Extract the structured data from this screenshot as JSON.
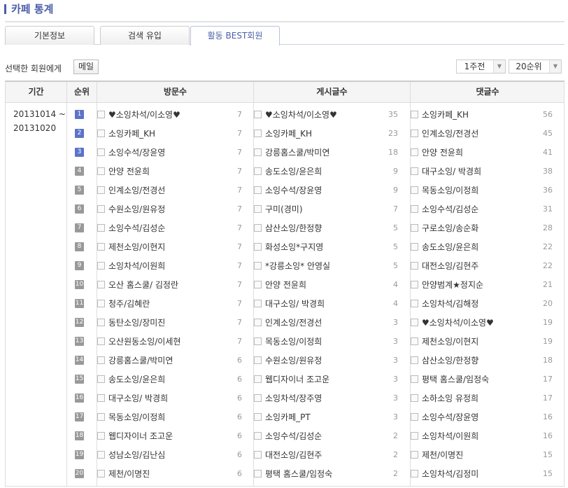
{
  "title": "카페 통계",
  "tabs": [
    {
      "label": "기본정보"
    },
    {
      "label": "검색 유입"
    },
    {
      "label": "활동 BEST회원"
    }
  ],
  "toolbar": {
    "selected_label": "선택한 회원에게",
    "mail_button": "메일",
    "period_select": "1주전",
    "rank_select": "20순위"
  },
  "table": {
    "headers": [
      "기간",
      "순위",
      "방문수",
      "게시글수",
      "댓글수"
    ],
    "period": [
      "20131014 ~",
      "20131020"
    ],
    "rows": [
      {
        "rank": "1",
        "visit": [
          "♥소잉차석/이소영♥",
          "7"
        ],
        "post": [
          "♥소잉차석/이소영♥",
          "35"
        ],
        "comment": [
          "소잉카페_KH",
          "56"
        ]
      },
      {
        "rank": "2",
        "visit": [
          "소잉카페_KH",
          "7"
        ],
        "post": [
          "소잉카페_KH",
          "23"
        ],
        "comment": [
          "인계소잉/전경선",
          "45"
        ]
      },
      {
        "rank": "3",
        "visit": [
          "소잉수석/장윤영",
          "7"
        ],
        "post": [
          "강릉홈스쿨/박미연",
          "18"
        ],
        "comment": [
          "안양 전윤희",
          "41"
        ]
      },
      {
        "rank": "4",
        "visit": [
          "안양 전윤희",
          "7"
        ],
        "post": [
          "송도소잉/윤은희",
          "9"
        ],
        "comment": [
          "대구소잉/ 박경희",
          "38"
        ]
      },
      {
        "rank": "5",
        "visit": [
          "인계소잉/전경선",
          "7"
        ],
        "post": [
          "소잉수석/장윤영",
          "9"
        ],
        "comment": [
          "목동소잉/이정희",
          "36"
        ]
      },
      {
        "rank": "6",
        "visit": [
          "수원소잉/원유정",
          "7"
        ],
        "post": [
          "구미(경미)",
          "7"
        ],
        "comment": [
          "소잉수석/김성순",
          "31"
        ]
      },
      {
        "rank": "7",
        "visit": [
          "소잉수석/김성순",
          "7"
        ],
        "post": [
          "삼산소잉/한정향",
          "5"
        ],
        "comment": [
          "구로소잉/송순화",
          "28"
        ]
      },
      {
        "rank": "8",
        "visit": [
          "제천소잉/이현지",
          "7"
        ],
        "post": [
          "화성소잉*구지영",
          "5"
        ],
        "comment": [
          "송도소잉/윤은희",
          "22"
        ]
      },
      {
        "rank": "9",
        "visit": [
          "소잉차석/이원희",
          "7"
        ],
        "post": [
          "*강릉소잉* 안영실",
          "5"
        ],
        "comment": [
          "대전소잉/김현주",
          "22"
        ]
      },
      {
        "rank": "10",
        "visit": [
          "오산 홈스쿨/ 김정란",
          "7"
        ],
        "post": [
          "안양 전윤희",
          "4"
        ],
        "comment": [
          "안양범계★정지순",
          "21"
        ]
      },
      {
        "rank": "11",
        "visit": [
          "청주/김혜란",
          "7"
        ],
        "post": [
          "대구소잉/ 박경희",
          "4"
        ],
        "comment": [
          "소잉차석/김해정",
          "20"
        ]
      },
      {
        "rank": "12",
        "visit": [
          "동탄소잉/장미진",
          "7"
        ],
        "post": [
          "인계소잉/전경선",
          "3"
        ],
        "comment": [
          "♥소잉차석/이소영♥",
          "19"
        ]
      },
      {
        "rank": "13",
        "visit": [
          "오산원동소잉/이세현",
          "7"
        ],
        "post": [
          "목동소잉/이정희",
          "3"
        ],
        "comment": [
          "제천소잉/이현지",
          "19"
        ]
      },
      {
        "rank": "14",
        "visit": [
          "강릉홈스쿨/박미연",
          "6"
        ],
        "post": [
          "수원소잉/원유정",
          "3"
        ],
        "comment": [
          "삼산소잉/한정향",
          "18"
        ]
      },
      {
        "rank": "15",
        "visit": [
          "송도소잉/윤은희",
          "6"
        ],
        "post": [
          "웹디자이너 조고운",
          "3"
        ],
        "comment": [
          "평택 홈스쿨/임정숙",
          "17"
        ]
      },
      {
        "rank": "16",
        "visit": [
          "대구소잉/ 박경희",
          "6"
        ],
        "post": [
          "소잉차석/장주영",
          "3"
        ],
        "comment": [
          "소하소잉 유정희",
          "17"
        ]
      },
      {
        "rank": "17",
        "visit": [
          "목동소잉/이정희",
          "6"
        ],
        "post": [
          "소잉카페_PT",
          "3"
        ],
        "comment": [
          "소잉수석/장윤영",
          "16"
        ]
      },
      {
        "rank": "18",
        "visit": [
          "웹디자이너 조고운",
          "6"
        ],
        "post": [
          "소잉수석/김성순",
          "2"
        ],
        "comment": [
          "소잉차석/이원희",
          "16"
        ]
      },
      {
        "rank": "19",
        "visit": [
          "성남소잉/김난심",
          "6"
        ],
        "post": [
          "대전소잉/김현주",
          "2"
        ],
        "comment": [
          "제천/이명진",
          "15"
        ]
      },
      {
        "rank": "20",
        "visit": [
          "제천/이명진",
          "6"
        ],
        "post": [
          "평택 홈스쿨/임정숙",
          "2"
        ],
        "comment": [
          "소잉차석/김정미",
          "15"
        ]
      }
    ]
  },
  "colors": {
    "accent": "#4a5ea8",
    "rank_top": "#5b73c9",
    "rank_other": "#999999"
  }
}
